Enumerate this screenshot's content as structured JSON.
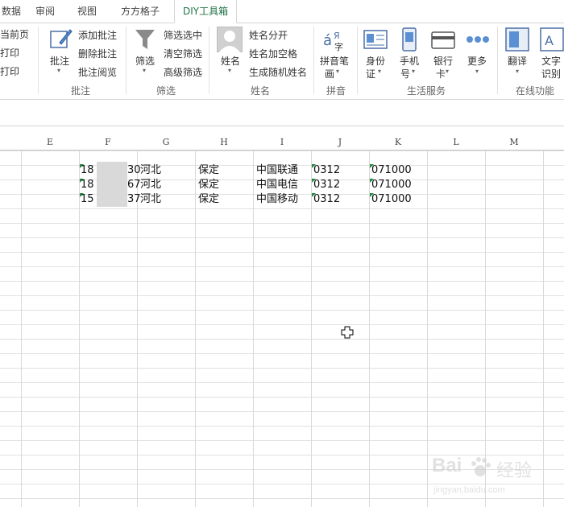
{
  "tabs": [
    {
      "label": "数据"
    },
    {
      "label": "审阅"
    },
    {
      "label": "视图"
    },
    {
      "label": "方方格子"
    },
    {
      "label": "DIY工具箱"
    }
  ],
  "ribbon": {
    "print": {
      "items": [
        "当前页",
        "打印",
        "打印"
      ]
    },
    "annotation": {
      "big_label": "批注",
      "items": [
        "添加批注",
        "删除批注",
        "批注阅览"
      ],
      "group": "批注"
    },
    "filter": {
      "big_label": "筛选",
      "items": [
        "筛选选中",
        "清空筛选",
        "高级筛选"
      ],
      "group": "筛选"
    },
    "name": {
      "big_label": "姓名",
      "items": [
        "姓名分开",
        "姓名加空格",
        "生成随机姓名"
      ],
      "group": "姓名"
    },
    "pinyin": {
      "big_label_line1": "拼音笔",
      "big_label_line2": "画",
      "group": "拼音"
    },
    "life": {
      "buttons": [
        {
          "line1": "身份",
          "line2": "证"
        },
        {
          "line1": "手机",
          "line2": "号"
        },
        {
          "line1": "银行",
          "line2": "卡"
        },
        {
          "line1": "更多",
          "line2": ""
        }
      ],
      "group": "生活服务"
    },
    "online": {
      "buttons": [
        {
          "line1": "翻译",
          "line2": ""
        },
        {
          "line1": "文字",
          "line2": "识别"
        }
      ],
      "group": "在线功能"
    }
  },
  "columns": [
    "E",
    "F",
    "G",
    "H",
    "I",
    "J",
    "K",
    "L",
    "M"
  ],
  "rows": [
    {
      "F": "18",
      "F_end": "30",
      "G": "河北",
      "H": "保定",
      "I": "中国联通",
      "J": "0312",
      "K": "071000"
    },
    {
      "F": "18",
      "F_end": "67",
      "G": "河北",
      "H": "保定",
      "I": "中国电信",
      "J": "0312",
      "K": "071000"
    },
    {
      "F": "15",
      "F_end": "37",
      "G": "河北",
      "H": "保定",
      "I": "中国移动",
      "J": "0312",
      "K": "071000"
    }
  ],
  "watermark": {
    "line1": "Bai",
    "line2": "经验",
    "url": "jingyan.baidu.com"
  }
}
